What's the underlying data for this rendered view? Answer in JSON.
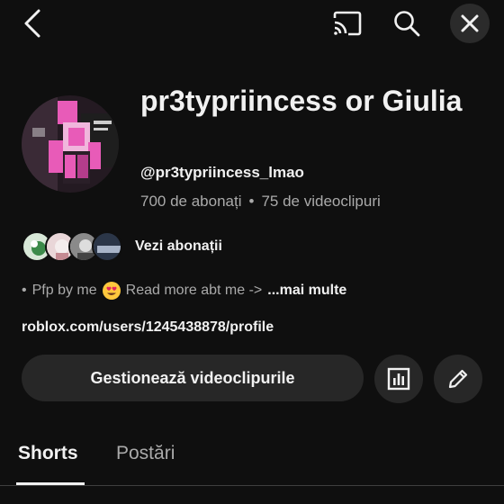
{
  "topbar": {
    "icons": [
      "back-icon",
      "cast-icon",
      "search-icon",
      "close-icon"
    ]
  },
  "channel": {
    "name": "pr3typriincess or Giulia",
    "handle": "@pr3typriincess_lmao",
    "subscribers": "700 de abonați",
    "separator": "•",
    "videos": "75 de videoclipuri"
  },
  "subscriptions": {
    "link_label": "Vezi abonații"
  },
  "description": {
    "bullet": "•",
    "text_before": "Pfp by me",
    "emoji": "heart-eyes-emoji",
    "text_after": "Read more abt me ->",
    "more_label": "...mai multe"
  },
  "link": "roblox.com/users/1245438878/profile",
  "actions": {
    "manage_videos": "Gestionează videoclipurile"
  },
  "tabs": [
    {
      "label": "Shorts",
      "active": true
    },
    {
      "label": "Postări",
      "active": false
    }
  ],
  "colors": {
    "background": "#0f0f0f",
    "button": "#272727",
    "text_primary": "#f1f1f1",
    "text_secondary": "#aaaaaa",
    "avatar_accent": "#e85bb8"
  }
}
